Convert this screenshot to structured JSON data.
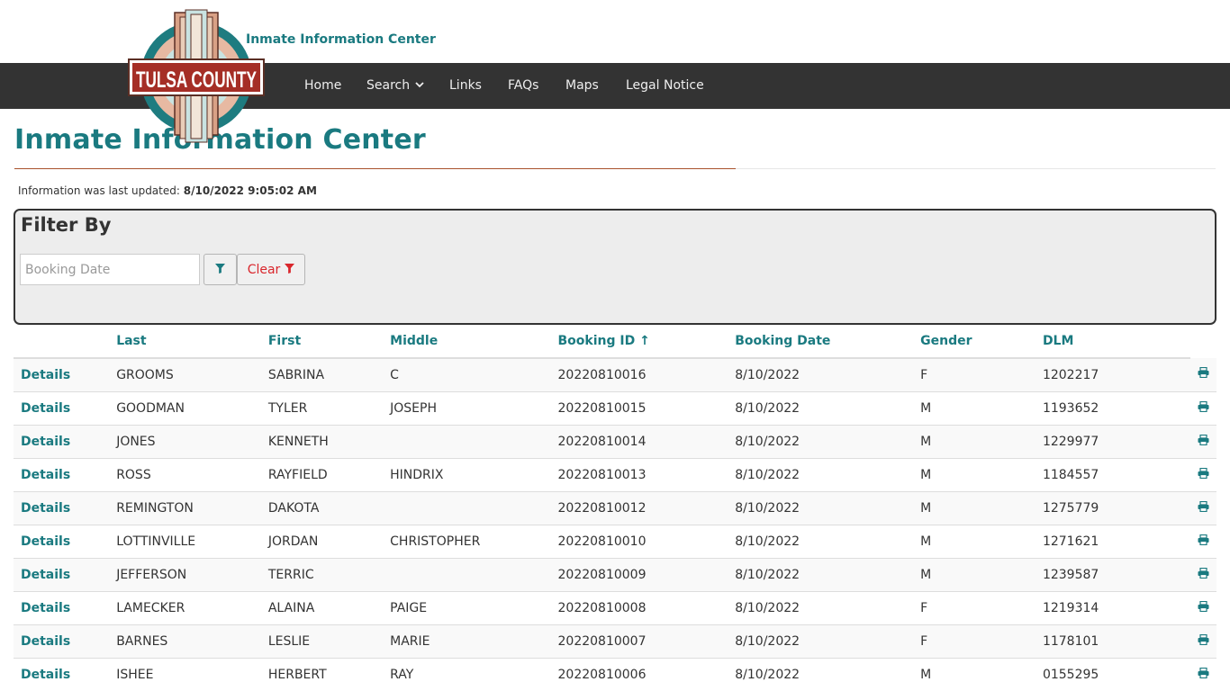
{
  "header": {
    "site_title": "Inmate Information Center",
    "logo_text": "TULSA COUNTY"
  },
  "nav": {
    "home": "Home",
    "search": "Search",
    "links": "Links",
    "faqs": "FAQs",
    "maps": "Maps",
    "legal": "Legal Notice"
  },
  "page": {
    "title": "Inmate Information Center",
    "updated_label": "Information was last updated:",
    "updated_value": "8/10/2022 9:05:02 AM"
  },
  "filter": {
    "title": "Filter By",
    "date_placeholder": "Booking Date",
    "date_value": "",
    "clear_label": "Clear"
  },
  "table": {
    "headers": [
      "Last",
      "First",
      "Middle",
      "Booking ID ↑",
      "Booking Date",
      "Gender",
      "DLM"
    ],
    "details_label": "Details",
    "rows": [
      [
        "GROOMS",
        "SABRINA",
        "C",
        "20220810016",
        "8/10/2022",
        "F",
        "1202217"
      ],
      [
        "GOODMAN",
        "TYLER",
        "JOSEPH",
        "20220810015",
        "8/10/2022",
        "M",
        "1193652"
      ],
      [
        "JONES",
        "KENNETH",
        "",
        "20220810014",
        "8/10/2022",
        "M",
        "1229977"
      ],
      [
        "ROSS",
        "RAYFIELD",
        "HINDRIX",
        "20220810013",
        "8/10/2022",
        "M",
        "1184557"
      ],
      [
        "REMINGTON",
        "DAKOTA",
        "",
        "20220810012",
        "8/10/2022",
        "M",
        "1275779"
      ],
      [
        "LOTTINVILLE",
        "JORDAN",
        "CHRISTOPHER",
        "20220810010",
        "8/10/2022",
        "M",
        "1271621"
      ],
      [
        "JEFFERSON",
        "TERRIC",
        "",
        "20220810009",
        "8/10/2022",
        "M",
        "1239587"
      ],
      [
        "LAMECKER",
        "ALAINA",
        "PAIGE",
        "20220810008",
        "8/10/2022",
        "F",
        "1219314"
      ],
      [
        "BARNES",
        "LESLIE",
        "MARIE",
        "20220810007",
        "8/10/2022",
        "F",
        "1178101"
      ],
      [
        "ISHEE",
        "HERBERT",
        "RAY",
        "20220810006",
        "8/10/2022",
        "M",
        "0155295"
      ]
    ]
  },
  "colors": {
    "accent": "#1a7a80",
    "nav_bg": "#333333",
    "clear_red": "#d9262c",
    "title_rule": "#a8522b"
  },
  "icons": {
    "filter": "filter-icon",
    "print": "print-icon",
    "chevron": "chevron-down-icon"
  }
}
